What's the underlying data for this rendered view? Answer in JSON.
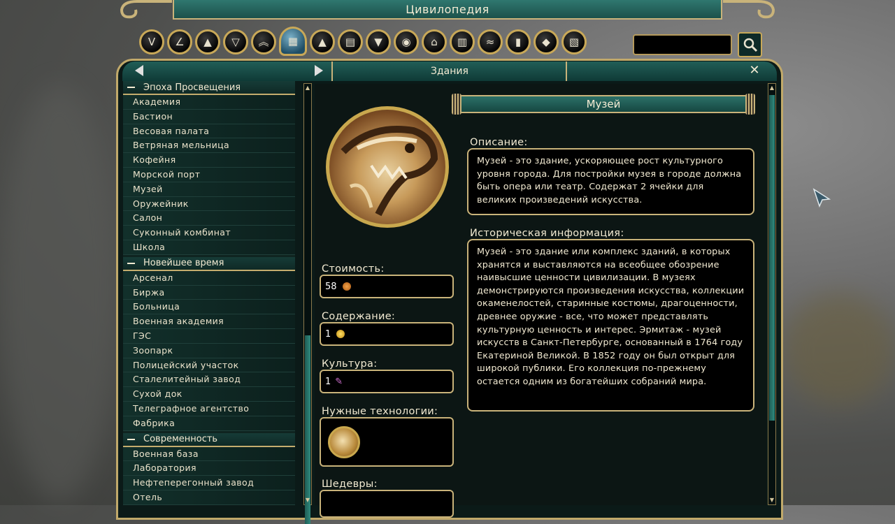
{
  "window": {
    "title": "Цивилопедия"
  },
  "categories": [
    {
      "icon": "v-icon",
      "glyph": "V"
    },
    {
      "icon": "compass-icon",
      "glyph": "∠"
    },
    {
      "icon": "triangle-icon",
      "glyph": "▲"
    },
    {
      "icon": "pennant-icon",
      "glyph": "▽"
    },
    {
      "icon": "chevrons-icon",
      "glyph": "︽"
    },
    {
      "icon": "building-icon",
      "glyph": "▦"
    },
    {
      "icon": "pyramid-icon",
      "glyph": "▲"
    },
    {
      "icon": "scroll-icon",
      "glyph": "▤"
    },
    {
      "icon": "policy-icon",
      "glyph": "▼"
    },
    {
      "icon": "globe-icon",
      "glyph": "◉"
    },
    {
      "icon": "capitol-icon",
      "glyph": "⌂"
    },
    {
      "icon": "city-icon",
      "glyph": "▥"
    },
    {
      "icon": "handshake-icon",
      "glyph": "≈"
    },
    {
      "icon": "towers-icon",
      "glyph": "▮"
    },
    {
      "icon": "resource-icon",
      "glyph": "◆"
    },
    {
      "icon": "map-icon",
      "glyph": "▧"
    }
  ],
  "search": {
    "placeholder": ""
  },
  "nav": {
    "section_title": "Здания",
    "close_glyph": "✕"
  },
  "sidebar": {
    "eras": [
      {
        "name": "Эпоха Просвещения",
        "items": [
          "Академия",
          "Бастион",
          "Весовая палата",
          "Ветряная мельница",
          "Кофейня",
          "Морской порт",
          "Музей",
          "Оружейник",
          "Салон",
          "Суконный комбинат",
          "Школа"
        ]
      },
      {
        "name": "Новейшее время",
        "items": [
          "Арсенал",
          "Биржа",
          "Больница",
          "Военная академия",
          "ГЭС",
          "Зоопарк",
          "Полицейский участок",
          "Сталелитейный завод",
          "Сухой док",
          "Телеграфное агентство",
          "Фабрика"
        ]
      },
      {
        "name": "Современность",
        "items": [
          "Военная база",
          "Лаборатория",
          "Нефтеперегонный завод",
          "Отель"
        ]
      }
    ]
  },
  "building": {
    "name": "Музей",
    "cost_label": "Стоимость:",
    "cost_value": "58",
    "upkeep_label": "Содержание:",
    "upkeep_value": "1",
    "culture_label": "Культура:",
    "culture_value": "1",
    "tech_label": "Нужные технологии:",
    "wonders_label": "Шедевры:",
    "description_label": "Описание:",
    "description": "Музей - это здание, ускоряющее рост культурного уровня города. Для постройки музея в городе должна быть опера или театр. Содержат 2 ячейки для великих произведений искусства.",
    "history_label": "Историческая информация:",
    "history": "Музей - это здание или комплекс зданий, в которых хранятся и выставляются на всеобщее обозрение наивысшие ценности цивилизации. В музеях демонстрируются произведения искусства, коллекции окаменелостей, старинные костюмы, драгоценности, древнее оружие - все, что может представлять культурную ценность и интерес. Эрмитаж - музей искусств в Санкт-Петербурге, основанный в 1764 году Екатериной Великой. В 1852 году он был открыт для широкой публики. Его коллекция по-прежнему остается одним из богатейших собраний мира."
  },
  "colors": {
    "accent_gold": "#c9b37a",
    "panel_teal": "#1c514b",
    "culture": "#d070d0",
    "gold_coin": "#e8b21a"
  }
}
